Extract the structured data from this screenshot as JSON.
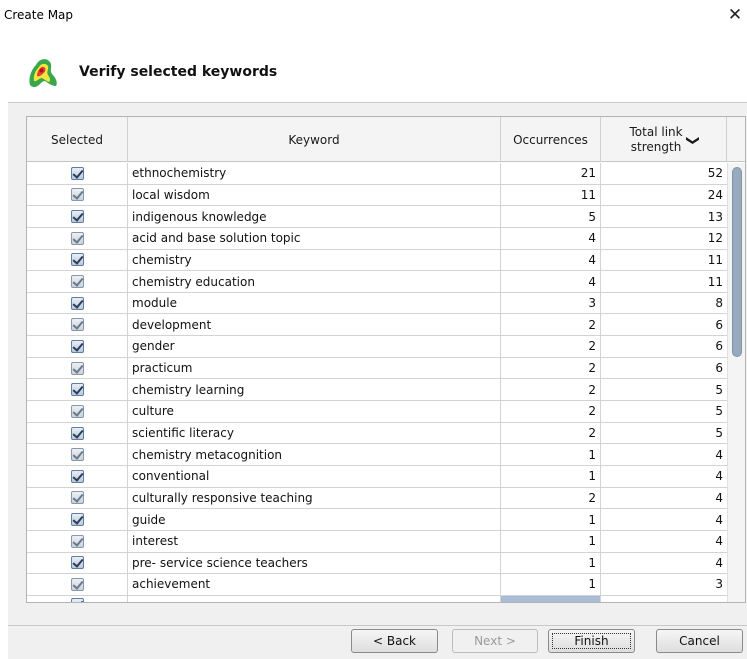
{
  "window": {
    "title": "Create Map",
    "close_glyph": "✕"
  },
  "header": {
    "title": "Verify selected keywords",
    "logo_icon": "heatmap-logo-icon"
  },
  "table": {
    "columns": {
      "selected": "Selected",
      "keyword": "Keyword",
      "occurrences": "Occurrences",
      "total_link_strength_line1": "Total link",
      "total_link_strength_line2": "strength",
      "sort_glyph": "❯"
    },
    "rows": [
      {
        "selected": true,
        "keyword": "ethnochemistry",
        "occurrences": "21",
        "total_link_strength": "52"
      },
      {
        "selected": true,
        "keyword": "local wisdom",
        "occurrences": "11",
        "total_link_strength": "24"
      },
      {
        "selected": true,
        "keyword": "indigenous knowledge",
        "occurrences": "5",
        "total_link_strength": "13"
      },
      {
        "selected": true,
        "keyword": "acid and base solution topic",
        "occurrences": "4",
        "total_link_strength": "12"
      },
      {
        "selected": true,
        "keyword": "chemistry",
        "occurrences": "4",
        "total_link_strength": "11"
      },
      {
        "selected": true,
        "keyword": "chemistry education",
        "occurrences": "4",
        "total_link_strength": "11"
      },
      {
        "selected": true,
        "keyword": "module",
        "occurrences": "3",
        "total_link_strength": "8"
      },
      {
        "selected": true,
        "keyword": "development",
        "occurrences": "2",
        "total_link_strength": "6"
      },
      {
        "selected": true,
        "keyword": "gender",
        "occurrences": "2",
        "total_link_strength": "6"
      },
      {
        "selected": true,
        "keyword": "practicum",
        "occurrences": "2",
        "total_link_strength": "6"
      },
      {
        "selected": true,
        "keyword": "chemistry learning",
        "occurrences": "2",
        "total_link_strength": "5"
      },
      {
        "selected": true,
        "keyword": "culture",
        "occurrences": "2",
        "total_link_strength": "5"
      },
      {
        "selected": true,
        "keyword": "scientific literacy",
        "occurrences": "2",
        "total_link_strength": "5"
      },
      {
        "selected": true,
        "keyword": "chemistry metacognition",
        "occurrences": "1",
        "total_link_strength": "4"
      },
      {
        "selected": true,
        "keyword": "conventional",
        "occurrences": "1",
        "total_link_strength": "4"
      },
      {
        "selected": true,
        "keyword": "culturally responsive teaching",
        "occurrences": "2",
        "total_link_strength": "4"
      },
      {
        "selected": true,
        "keyword": "guide",
        "occurrences": "1",
        "total_link_strength": "4"
      },
      {
        "selected": true,
        "keyword": "interest",
        "occurrences": "1",
        "total_link_strength": "4"
      },
      {
        "selected": true,
        "keyword": "pre- service science teachers",
        "occurrences": "1",
        "total_link_strength": "4"
      },
      {
        "selected": true,
        "keyword": "achievement",
        "occurrences": "1",
        "total_link_strength": "3"
      }
    ]
  },
  "buttons": {
    "back": "< Back",
    "next": "Next >",
    "finish": "Finish",
    "cancel": "Cancel"
  }
}
